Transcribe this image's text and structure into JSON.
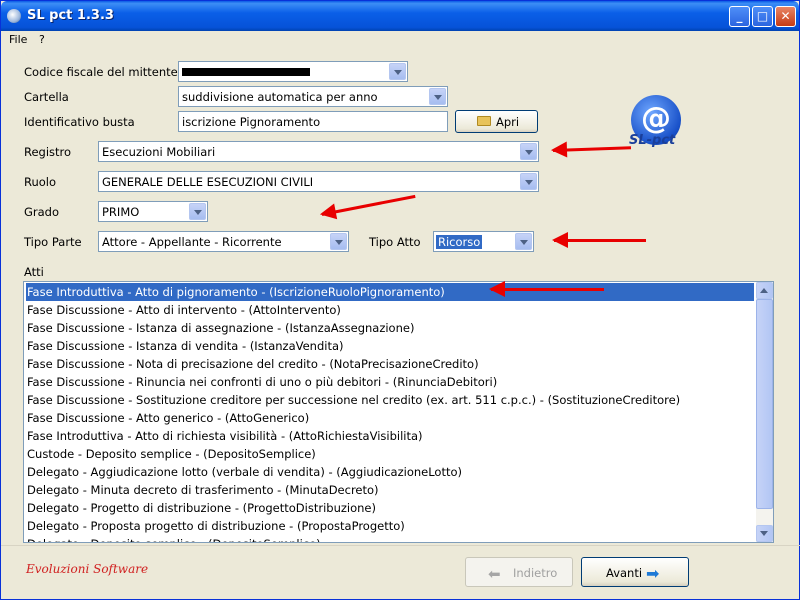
{
  "window": {
    "title": "SL pct 1.3.3",
    "minimize": "_",
    "maximize": "□",
    "close": "✕"
  },
  "menu": {
    "file": "File",
    "help": "?"
  },
  "form": {
    "codice_label": "Codice fiscale del mittente",
    "codice_value": "",
    "cartella_label": "Cartella",
    "cartella_value": "suddivisione automatica per anno",
    "busta_label": "Identificativo busta",
    "busta_value": "iscrizione Pignoramento",
    "apri_label": "Apri",
    "registro_label": "Registro",
    "registro_value": "Esecuzioni Mobiliari",
    "ruolo_label": "Ruolo",
    "ruolo_value": "GENERALE DELLE ESECUZIONI CIVILI",
    "grado_label": "Grado",
    "grado_value": "PRIMO",
    "tipo_parte_label": "Tipo Parte",
    "tipo_parte_value": "Attore - Appellante - Ricorrente",
    "tipo_atto_label": "Tipo Atto",
    "tipo_atto_value": "Ricorso"
  },
  "logo_badge": {
    "symbol": "@",
    "text": "SL-pct"
  },
  "atti": {
    "label": "Atti",
    "items": [
      "Fase Introduttiva - Atto di pignoramento - (IscrizioneRuoloPignoramento)",
      "Fase Discussione - Atto di intervento - (AttoIntervento)",
      "Fase Discussione - Istanza di assegnazione - (IstanzaAssegnazione)",
      "Fase Discussione - Istanza di vendita - (IstanzaVendita)",
      "Fase Discussione - Nota di precisazione del credito - (NotaPrecisazioneCredito)",
      "Fase Discussione - Rinuncia nei confronti di uno o più debitori - (RinunciaDebitori)",
      "Fase Discussione - Sostituzione creditore per successione nel credito (ex. art. 511 c.p.c.) - (SostituzioneCreditore)",
      "Fase Discussione - Atto generico - (AttoGenerico)",
      "Fase Introduttiva - Atto di richiesta visibilità - (AttoRichiestaVisibilita)",
      "Custode - Deposito semplice - (DepositoSemplice)",
      "Delegato - Aggiudicazione lotto (verbale di vendita) - (AggiudicazioneLotto)",
      "Delegato - Minuta decreto di trasferimento - (MinutaDecreto)",
      "Delegato - Progetto di distribuzione - (ProgettoDistribuzione)",
      "Delegato - Proposta progetto di distribuzione - (PropostaProgetto)",
      "Delegato - Deposito semplice - (DepositoSemplice)"
    ],
    "selected_index": 0
  },
  "footer": {
    "brand": "Evoluzioni Software",
    "back_label": "Indietro",
    "next_label": "Avanti"
  },
  "colors": {
    "selection": "#316ac5",
    "annotation_arrow": "#e80000",
    "title_bar": "#0a5fe8"
  }
}
